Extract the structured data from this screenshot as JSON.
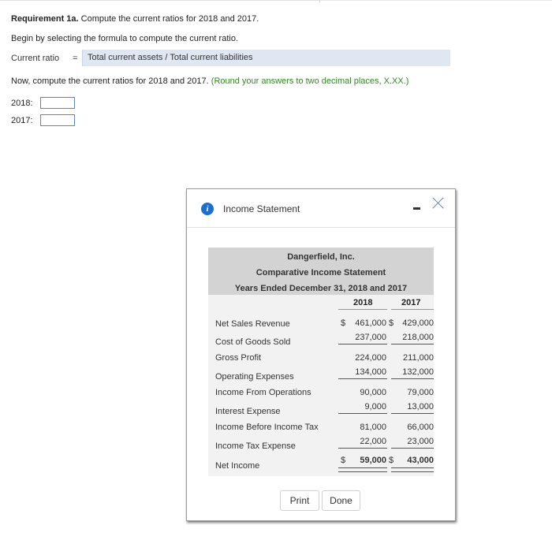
{
  "requirement": {
    "bold_part": "Requirement 1a.",
    "rest": " Compute the current ratios for 2018 and 2017."
  },
  "begin_text": "Begin by selecting the formula to compute the current ratio.",
  "formula": {
    "label": "Current ratio",
    "equals": "=",
    "value": "Total current assets / Total current liabilities"
  },
  "instruction": {
    "text": "Now, compute the current ratios for 2018 and 2017.",
    "note": "(Round your answers to two decimal places, X.XX.)"
  },
  "answers": [
    {
      "label": "2018:",
      "value": ""
    },
    {
      "label": "2017:",
      "value": ""
    }
  ],
  "dialog": {
    "title": "Income Statement",
    "icon": "info-icon",
    "minimize_icon": "minimize-icon",
    "close_icon": "close-icon",
    "company": "Dangerfield, Inc.",
    "statement_title": "Comparative Income Statement",
    "period": "Years Ended December 31, 2018 and 2017",
    "years": [
      "2018",
      "2017"
    ],
    "rows": [
      {
        "label": "Net Sales Revenue",
        "v2018": "461,000",
        "v2017": "429,000",
        "dollar2018": "$",
        "dollar2017": "$"
      },
      {
        "label": "Cost of Goods Sold",
        "v2018": "237,000",
        "v2017": "218,000"
      },
      {
        "label": "Gross Profit",
        "v2018": "224,000",
        "v2017": "211,000"
      },
      {
        "label": "Operating Expenses",
        "v2018": "134,000",
        "v2017": "132,000"
      },
      {
        "label": "Income From Operations",
        "v2018": "90,000",
        "v2017": "79,000"
      },
      {
        "label": "Interest Expense",
        "v2018": "9,000",
        "v2017": "13,000"
      },
      {
        "label": "Income Before Income Tax",
        "v2018": "81,000",
        "v2017": "66,000"
      },
      {
        "label": "Income Tax Expense",
        "v2018": "22,000",
        "v2017": "23,000"
      },
      {
        "label": "Net Income",
        "v2018": "59,000",
        "v2017": "43,000",
        "dollar2018": "$",
        "dollar2017": "$"
      }
    ],
    "buttons": {
      "print": "Print",
      "done": "Done"
    }
  }
}
